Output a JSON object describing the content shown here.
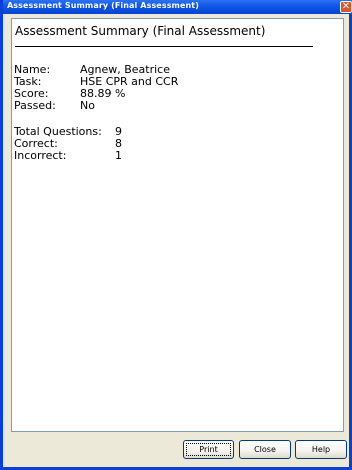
{
  "window": {
    "title": "Assessment Summary (Final Assessment)",
    "close_glyph": "✕"
  },
  "summary": {
    "heading": "Assessment Summary (Final Assessment)",
    "fields": {
      "name_label": "Name:",
      "name_value": "Agnew, Beatrice",
      "task_label": "Task:",
      "task_value": "HSE  CPR and CCR",
      "score_label": "Score:",
      "score_value": "88.89 %",
      "passed_label": "Passed:",
      "passed_value": "No"
    },
    "totals": {
      "total_label": "Total Questions:",
      "total_value": "9",
      "correct_label": "Correct:",
      "correct_value": "8",
      "incorrect_label": "Incorrect:",
      "incorrect_value": "1"
    }
  },
  "footer": {
    "print_label": "Print",
    "close_label": "Close",
    "help_label": "Help"
  },
  "colors": {
    "titlebar": "#0f55e6",
    "window_frame": "#0a3fd8",
    "close_button": "#d9562f",
    "dialog_background": "#ece9d8"
  }
}
